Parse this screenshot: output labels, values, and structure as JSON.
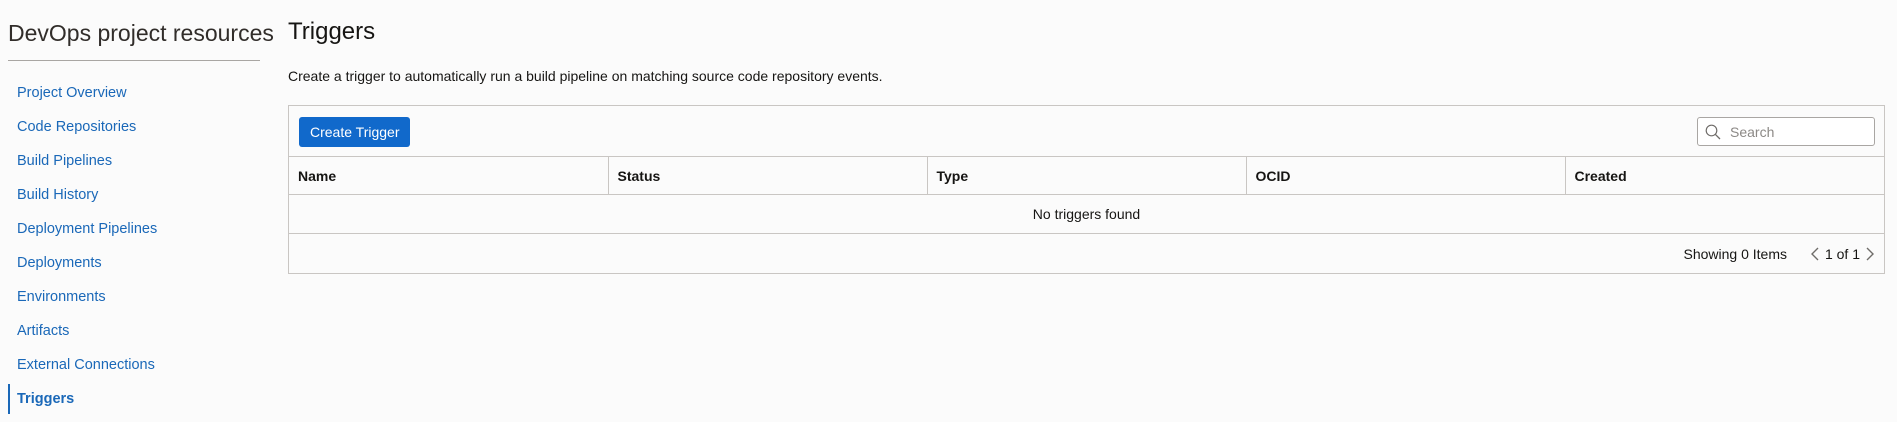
{
  "sidebar": {
    "title": "DevOps project resources",
    "items": [
      {
        "label": "Project Overview"
      },
      {
        "label": "Code Repositories"
      },
      {
        "label": "Build Pipelines"
      },
      {
        "label": "Build History"
      },
      {
        "label": "Deployment Pipelines"
      },
      {
        "label": "Deployments"
      },
      {
        "label": "Environments"
      },
      {
        "label": "Artifacts"
      },
      {
        "label": "External Connections"
      },
      {
        "label": "Triggers",
        "active": true
      }
    ]
  },
  "main": {
    "title": "Triggers",
    "description": "Create a trigger to automatically run a build pipeline on matching source code repository events.",
    "create_button_label": "Create Trigger",
    "search": {
      "placeholder": "Search",
      "value": ""
    },
    "table": {
      "columns": [
        "Name",
        "Status",
        "Type",
        "OCID",
        "Created"
      ],
      "rows": [],
      "empty_message": "No triggers found"
    },
    "footer": {
      "showing": "Showing 0 Items",
      "pagination": "1 of 1"
    }
  },
  "colors": {
    "link": "#1a68b8",
    "primary_button": "#1169cb",
    "border": "#c9c6c3",
    "background": "#fbfbfb"
  },
  "icons": {
    "search": "search-icon",
    "prev": "chevron-left-icon",
    "next": "chevron-right-icon"
  }
}
